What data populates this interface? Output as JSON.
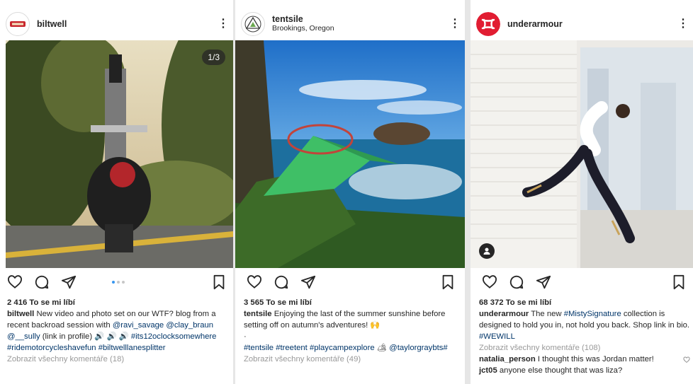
{
  "posts": [
    {
      "username": "biltwell",
      "location": "",
      "counter": "1/3",
      "likes": "2 416 To se mi líbí",
      "caption_user": "biltwell",
      "caption_a": "New video and photo set on our WTF? blog from a recent  backroad session with",
      "mention1": "@ravi_savage",
      "mention2": "@clay_braun",
      "mention3": "@__sully",
      "caption_b": "(link in profile)",
      "caption_emoji": "🔊 🔊 🔊",
      "hashtags1": "#its12oclocksomewhere #ridemotorcycleshavefun",
      "hashtags2": "#biltwelllanesplitter",
      "view_comments": "Zobrazit všechny komentáře (18)"
    },
    {
      "username": "tentsile",
      "location": "Brookings, Oregon",
      "likes": "3 565 To se mi líbí",
      "caption_user": "tentsile",
      "caption_a": "Enjoying the last of the summer sunshine before setting off on autumn's adventures!",
      "caption_emoji": "🙌",
      "bullet": "·",
      "hashtags1": "#tentsile #treetent #playcampexplore",
      "hashtags_emoji": "🏕",
      "hashtags2": "@taylorgraybts#",
      "view_comments": "Zobrazit všechny komentáře (49)"
    },
    {
      "username": "underarmour",
      "location": "",
      "likes": "68 372 To se mi líbí",
      "caption_user": "underarmour",
      "caption_a": "The new",
      "hashtag_inline": "#MistySignature",
      "caption_b": "collection is designed to hold you in, not hold you back. Shop link in bio.",
      "hashtag_end": "#WEWILL",
      "view_comments": "Zobrazit všechny komentáře (108)",
      "comment1_user": "natalia_person",
      "comment1_text": "I thought this was Jordan matter!",
      "comment2_user": "jct05",
      "comment2_text": "anyone else thought that was liza?"
    }
  ],
  "icons": [
    "heart-icon",
    "comment-icon",
    "share-icon",
    "bookmark-icon",
    "more-icon"
  ],
  "colors": {
    "text": "#262626",
    "secondary": "#999999",
    "link": "#003569",
    "carousel_active": "#3897f0",
    "underarmour_red": "#e11d32"
  }
}
